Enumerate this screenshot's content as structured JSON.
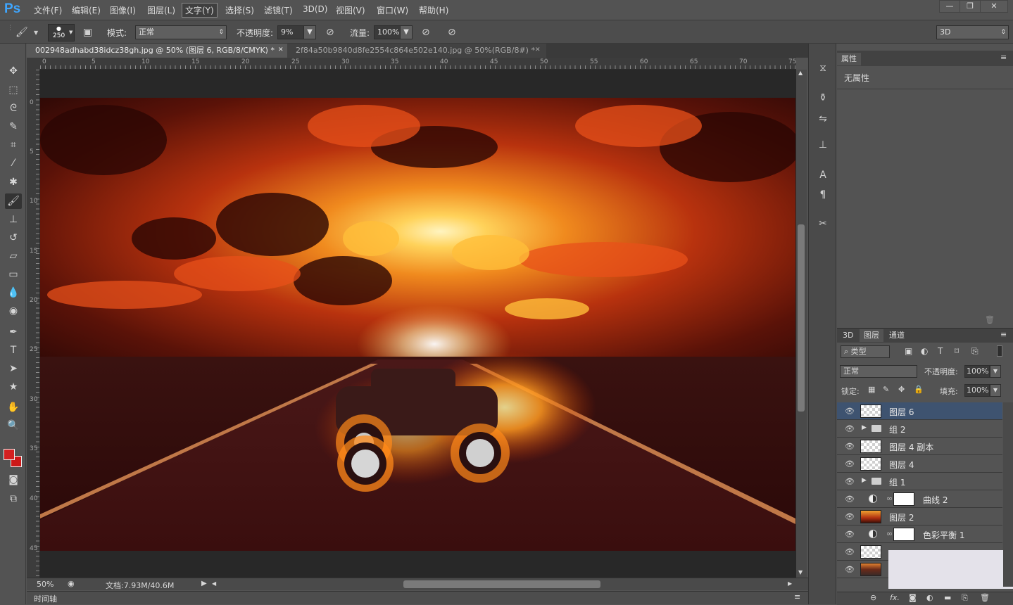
{
  "app": {
    "logo": "Ps"
  },
  "menu": [
    "文件(F)",
    "编辑(E)",
    "图像(I)",
    "图层(L)",
    "文字(Y)",
    "选择(S)",
    "滤镜(T)",
    "3D(D)",
    "视图(V)",
    "窗口(W)",
    "帮助(H)"
  ],
  "menu_active_index": 4,
  "window_buttons": [
    "—",
    "❐",
    "✕"
  ],
  "options": {
    "brush_size": "250",
    "mode_label": "模式:",
    "mode_value": "正常",
    "opacity_label": "不透明度:",
    "opacity_value": "9%",
    "flow_label": "流量:",
    "flow_value": "100%",
    "workspace": "3D"
  },
  "tabs": [
    {
      "title": "002948adhabd38idcz38gh.jpg @ 50% (图层 6, RGB/8/CMYK) *",
      "close": "✕",
      "active": true
    },
    {
      "title": "2f84a50b9840d8fe2554c864e502e140.jpg @ 50%(RGB/8#) *",
      "close": "✕",
      "active": false
    }
  ],
  "ruler_h": [
    "0",
    "5",
    "10",
    "15",
    "20",
    "25",
    "30",
    "35",
    "40",
    "45",
    "50",
    "55",
    "60",
    "65",
    "70",
    "75"
  ],
  "ruler_v": [
    "0",
    "5",
    "10",
    "15",
    "20",
    "25",
    "30",
    "35",
    "40",
    "45"
  ],
  "status": {
    "zoom": "50%",
    "doc_info": "文档:7.93M/40.6M"
  },
  "timeline_label": "时间轴",
  "properties": {
    "tab": "属性",
    "content": "无属性"
  },
  "layers_panel": {
    "tabs": [
      "3D",
      "图层",
      "通道"
    ],
    "active_tab": "图层",
    "filter_kind": "类型",
    "blend_mode": "正常",
    "opacity_label": "不透明度:",
    "opacity_value": "100%",
    "lock_label": "锁定:",
    "fill_label": "填充:",
    "fill_value": "100%",
    "layers": [
      {
        "name": "图层 6",
        "kind": "pixel",
        "selected": true
      },
      {
        "name": "组 2",
        "kind": "group"
      },
      {
        "name": "图层 4 副本",
        "kind": "pixel"
      },
      {
        "name": "图层 4",
        "kind": "pixel"
      },
      {
        "name": "组 1",
        "kind": "group"
      },
      {
        "name": "曲线 2",
        "kind": "adjustment"
      },
      {
        "name": "图层 2",
        "kind": "image"
      },
      {
        "name": "色彩平衡 1",
        "kind": "adjustment"
      },
      {
        "name": "",
        "kind": "pixel"
      },
      {
        "name": "",
        "kind": "image"
      }
    ]
  },
  "colors": {
    "foreground": "#d42020",
    "background": "#cc1818",
    "selection": "#3e5370",
    "ps_blue": "#3fa6ff"
  },
  "icons": [
    "move-icon",
    "marquee-icon",
    "lasso-icon",
    "quick-select-icon",
    "crop-icon",
    "eyedropper-icon",
    "healing-icon",
    "brush-icon",
    "stamp-icon",
    "history-brush-icon",
    "eraser-icon",
    "gradient-icon",
    "blur-icon",
    "dodge-icon",
    "pen-icon",
    "type-icon",
    "path-select-icon",
    "shape-icon",
    "hand-icon",
    "zoom-icon"
  ]
}
